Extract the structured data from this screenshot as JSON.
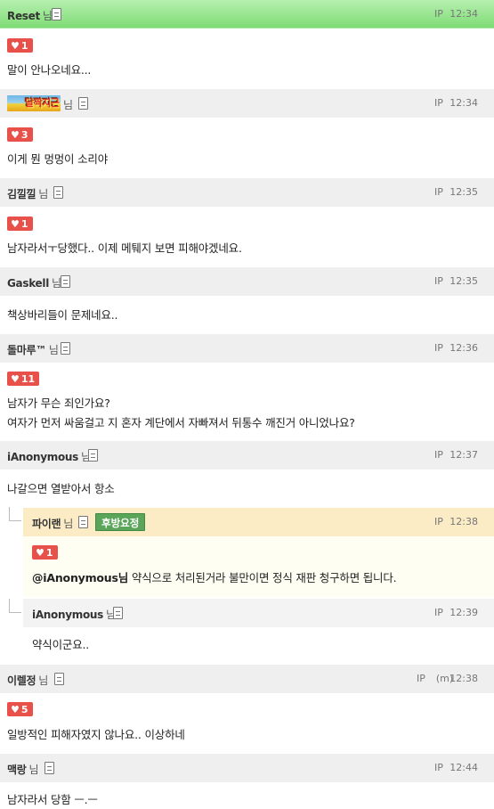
{
  "suffix": "님",
  "ip_label": "IP",
  "comments": [
    {
      "name": "Reset",
      "time": "12:34",
      "likes": "1",
      "text": "말이 안나오네요..."
    },
    {
      "name": "",
      "badge_text": "달짝지근",
      "time": "12:34",
      "likes": "3",
      "text": "이게 뭔 멍멍이 소리야"
    },
    {
      "name": "김낄낄",
      "time": "12:35",
      "likes": "1",
      "text": "남자라서ㅜ당했다.. 이제 메퉤지 보면 피해야겠네요."
    },
    {
      "name": "Gaskell",
      "time": "12:35",
      "text": "책상바리들이 문제네요.."
    },
    {
      "name": "돌마루™",
      "time": "12:36",
      "likes": "11",
      "text": "남자가 무슨 죄인가요?",
      "text2": "여자가 먼저 싸움걸고 지 혼자 계단에서 자빠져서 뒤통수 깨진거 아니었나요?"
    },
    {
      "name": "iAnonymous",
      "time": "12:37",
      "text": "나갈으면 열받아서 항소"
    },
    {
      "name": "파이랜",
      "tag": "후방요정",
      "time": "12:38",
      "likes": "1",
      "mention": "@iAnonymous님",
      "text": " 약식으로 처리된거라 불만이면 정식 재판 청구하면 됩니다."
    },
    {
      "name": "iAnonymous",
      "time": "12:39",
      "text": "약식이군요.."
    },
    {
      "name": "이렐정",
      "ip_extra": "(m)",
      "time": "12:38",
      "likes": "5",
      "text": "일방적인 피해자였지 않나요.. 이상하네"
    },
    {
      "name": "맥랑",
      "time": "12:44",
      "text": "남자라서 당함 ㅡ.ㅡ"
    }
  ]
}
